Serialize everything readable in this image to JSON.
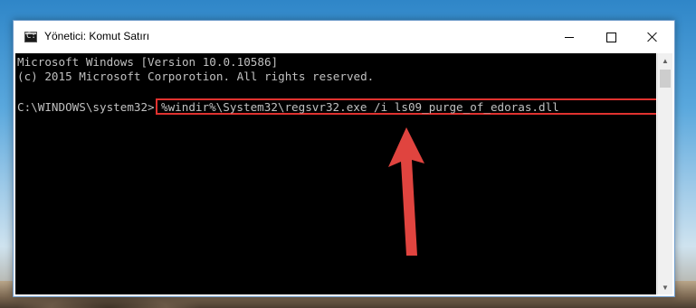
{
  "window": {
    "title": "Yönetici: Komut Satırı",
    "app_icon": "cmd-icon",
    "controls": {
      "minimize": "minimize-icon",
      "maximize": "maximize-icon",
      "close": "close-icon"
    }
  },
  "console": {
    "lines": [
      "Microsoft Windows [Version 10.0.10586]",
      "(c) 2015 Microsoft Corporotion. All rights reserved."
    ],
    "prompt": "C:\\WINDOWS\\system32>",
    "command": "%windir%\\System32\\regsvr32.exe /i ls09_purge_of_edoras.dll",
    "text_color": "#c0c0c0",
    "background": "#000000"
  },
  "annotation": {
    "highlight_color": "#e0322f",
    "arrow_color": "#e0443f"
  }
}
